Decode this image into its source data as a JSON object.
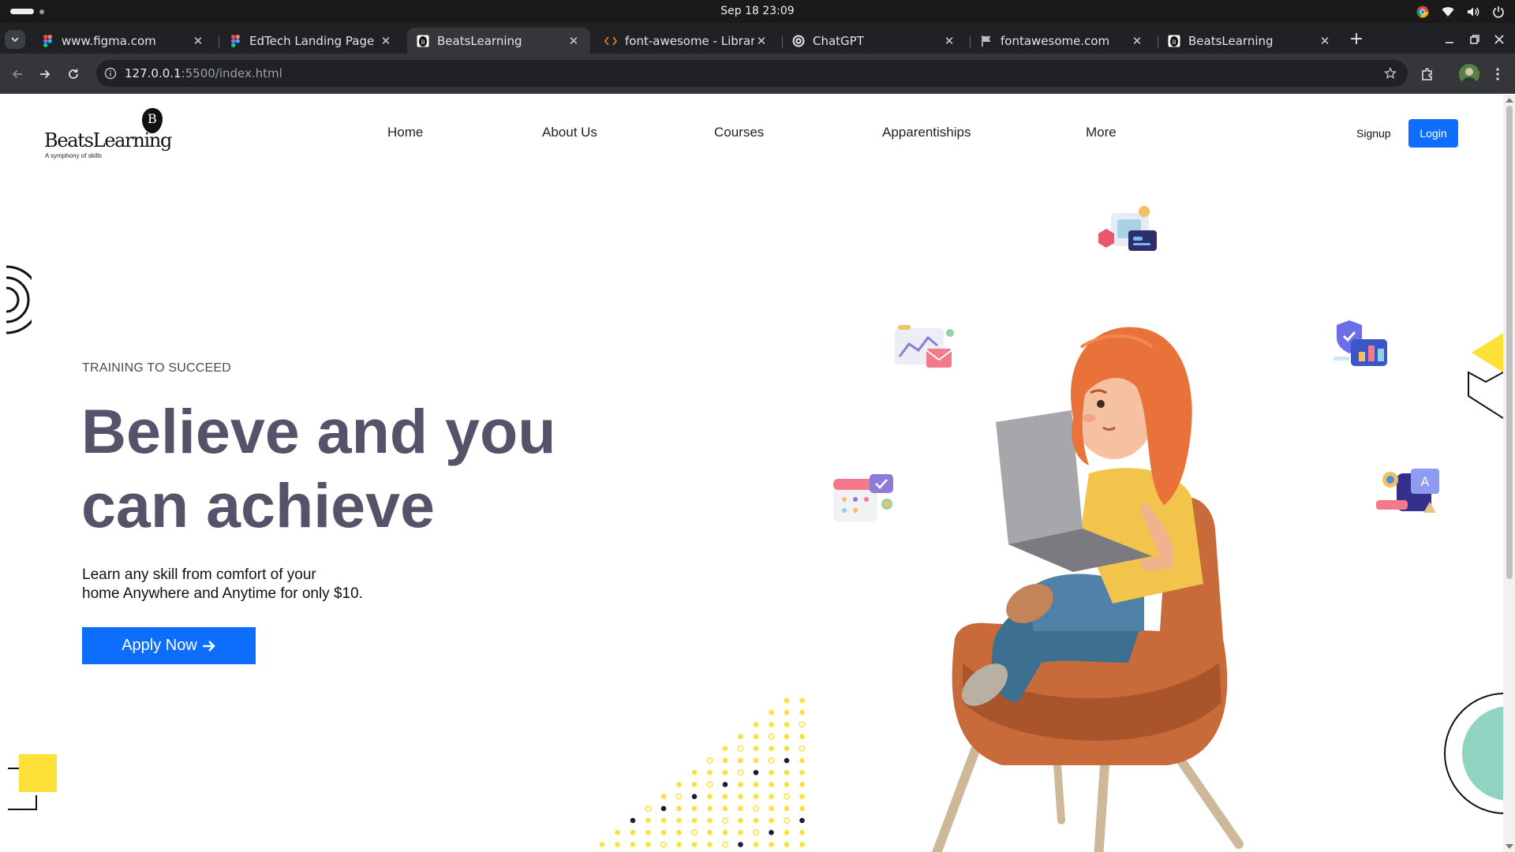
{
  "os": {
    "clock": "Sep 18  23:09",
    "tray_icons": [
      "chrome-icon",
      "wifi-icon",
      "volume-icon",
      "power-icon"
    ]
  },
  "browser": {
    "tabs": [
      {
        "title": "www.figma.com",
        "icon": "figma-icon",
        "active": false
      },
      {
        "title": "EdTech Landing Page (Co",
        "icon": "figma-icon",
        "active": false
      },
      {
        "title": "BeatsLearning",
        "icon": "beats-favicon",
        "active": true
      },
      {
        "title": "font-awesome - Libraries",
        "icon": "code-icon",
        "active": false
      },
      {
        "title": "ChatGPT",
        "icon": "chatgpt-icon",
        "active": false
      },
      {
        "title": "fontawesome.com",
        "icon": "flag-icon",
        "active": false
      },
      {
        "title": "BeatsLearning",
        "icon": "beats-favicon",
        "active": false
      }
    ],
    "url_host": "127.0.0.1",
    "url_rest": ":5500/index.html"
  },
  "site": {
    "logo_text": "BeatsLearning",
    "logo_tagline": "A symphony of skills",
    "logo_letter": "B",
    "nav": [
      "Home",
      "About Us",
      "Courses",
      "Apparentiships",
      "More"
    ],
    "signup": "Signup",
    "login": "Login",
    "hero": {
      "eyebrow": "TRAINING TO SUCCEED",
      "headline_line1": "Believe and you",
      "headline_line2": "can achieve",
      "sub_line1": "Learn any skill from comfort of your",
      "sub_line2": "home Anywhere and Anytime for only $10.",
      "cta": "Apply Now"
    }
  },
  "colors": {
    "accent_blue": "#0d6efd",
    "headline": "#55536a",
    "deco_yellow": "#fde038",
    "deco_mint": "#8fd3c0",
    "hair_orange": "#e8723a",
    "chair": "#c86a3a"
  }
}
